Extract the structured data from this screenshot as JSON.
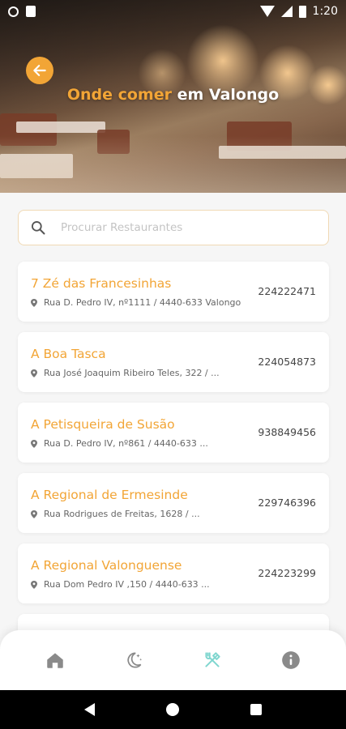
{
  "statusbar": {
    "time": "1:20"
  },
  "header": {
    "title_highlight": "Onde comer",
    "title_rest": "em Valongo"
  },
  "search": {
    "placeholder": "Procurar Restaurantes"
  },
  "restaurants": [
    {
      "name": "7 Zé das Francesinhas",
      "address": "Rua D. Pedro IV, nº1111 / 4440-633 Valongo",
      "phone": "224222471"
    },
    {
      "name": "A Boa Tasca",
      "address": "Rua José Joaquim Ribeiro Teles, 322 / ...",
      "phone": "224054873"
    },
    {
      "name": "A Petisqueira de Susão",
      "address": "Rua D. Pedro IV, nº861 / 4440-633 ...",
      "phone": "938849456"
    },
    {
      "name": "A Regional de Ermesinde",
      "address": "Rua Rodrigues de Freitas, 1628 / ...",
      "phone": "229746396"
    },
    {
      "name": "A Regional Valonguense",
      "address": "Rua Dom Pedro IV ,150 / 4440-633 ...",
      "phone": "224223299"
    }
  ],
  "bottom_nav": [
    {
      "icon": "home-icon",
      "active": false
    },
    {
      "icon": "night-icon",
      "active": false
    },
    {
      "icon": "restaurant-icon",
      "active": true
    },
    {
      "icon": "info-icon",
      "active": false
    }
  ],
  "colors": {
    "accent": "#f2a536",
    "active_nav": "#7fd6cf",
    "inactive_nav": "#8a8a8a"
  }
}
